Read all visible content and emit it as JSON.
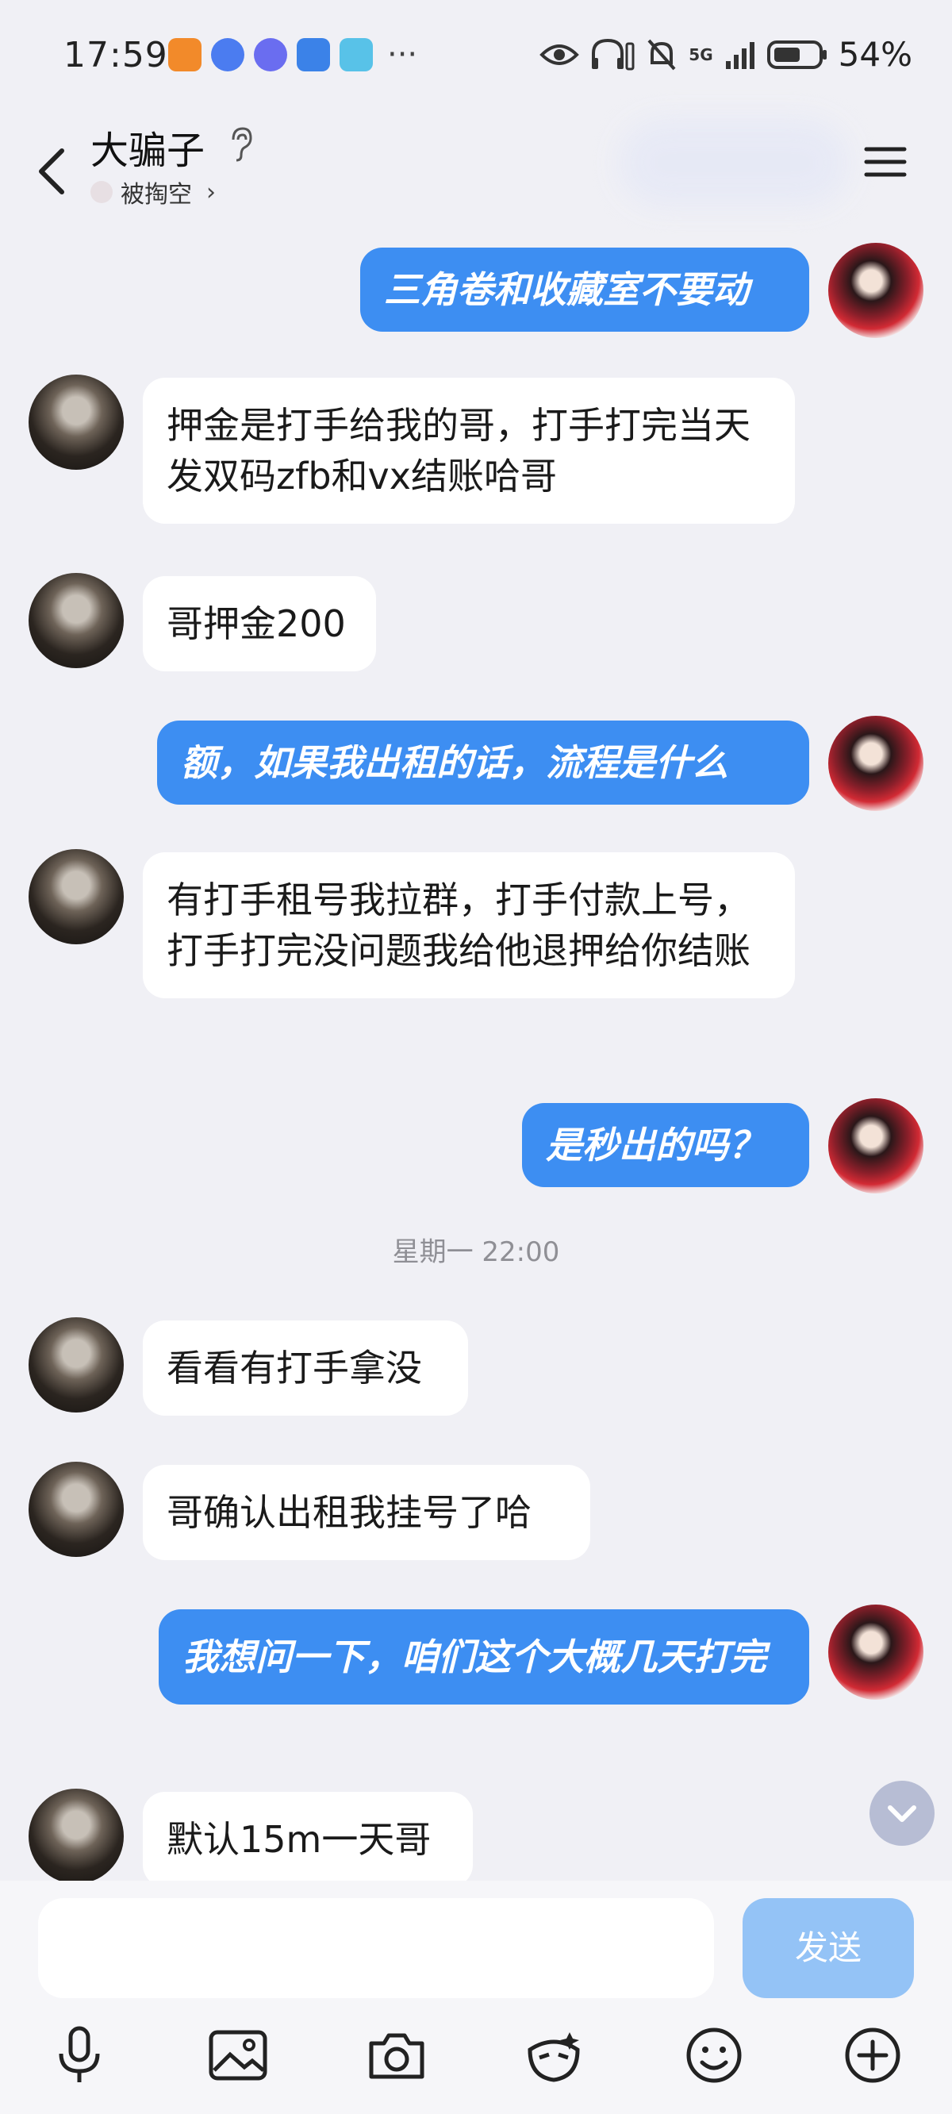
{
  "status_bar": {
    "time": "17:59",
    "network": "5G",
    "battery_percent": "54%",
    "overflow": "···"
  },
  "header": {
    "contact_name": "大骗子",
    "contact_status": "被掏空",
    "back_icon": "chevron-left-icon",
    "menu_icon": "hamburger-menu-icon"
  },
  "messages": [
    {
      "side": "out",
      "text": "三角卷和收藏室不要动"
    },
    {
      "side": "in",
      "text": "押金是打手给我的哥，打手打完当天发双码zfb和vx结账哈哥"
    },
    {
      "side": "in",
      "text": "哥押金200"
    },
    {
      "side": "out",
      "text": "额，如果我出租的话，流程是什么"
    },
    {
      "side": "in",
      "text": "有打手租号我拉群，打手付款上号，打手打完没问题我给他退押给你结账"
    },
    {
      "side": "out",
      "text": "是秒出的吗？"
    },
    {
      "side": "in",
      "text": "看看有打手拿没"
    },
    {
      "side": "in",
      "text": "哥确认出租我挂号了哈"
    },
    {
      "side": "out",
      "text": "我想问一下，咱们这个大概几天打完"
    },
    {
      "side": "in",
      "text": "默认15m一天哥"
    }
  ],
  "timestamp": "星期一 22:00",
  "input": {
    "value": "",
    "send_label": "发送"
  },
  "toolbar": [
    "microphone-icon",
    "image-icon",
    "camera-icon",
    "sticker-icon",
    "emoji-icon",
    "plus-icon"
  ],
  "colors": {
    "outgoing_bubble": "#3d8ef2",
    "incoming_bubble": "#ffffff",
    "background": "#f0f0f5",
    "send_button": "#94c3f6"
  }
}
